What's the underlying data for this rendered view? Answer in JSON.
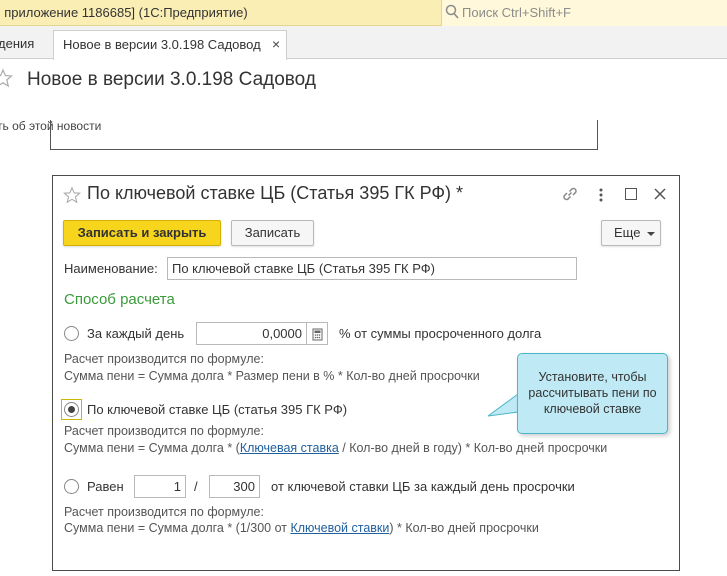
{
  "window": {
    "title": ", приложение 1186685]  (1С:Предприятие)",
    "search_placeholder": "Поиск Ctrl+Shift+F"
  },
  "tabs": [
    {
      "label": "дения"
    },
    {
      "label": "Новое в версии 3.0.198 Садовод",
      "close": "×"
    }
  ],
  "page": {
    "title": "Новое в версии 3.0.198 Садовод",
    "link": "ть об этой новости"
  },
  "dialog": {
    "title": "По ключевой ставке ЦБ (Статья 395 ГК РФ) *",
    "buttons": {
      "save_close": "Записать и закрыть",
      "save": "Записать",
      "more": "Еще"
    },
    "name_label": "Наименование:",
    "name_value": "По ключевой ставке ЦБ (Статья 395 ГК РФ)",
    "section_title": "Способ расчета",
    "options": [
      {
        "label": "За каждый день",
        "value": "0,0000",
        "suffix": "% от суммы просроченного долга",
        "selected": false,
        "formula_intro": "Расчет производится по формуле:",
        "formula": "Сумма пени = Сумма долга * Размер пени в % * Кол-во дней просрочки"
      },
      {
        "label": "По ключевой ставке ЦБ (статья 395 ГК РФ)",
        "selected": true,
        "formula_intro": "Расчет производится по формуле:",
        "formula_prefix": "Сумма пени = Сумма долга * (",
        "formula_link": "Ключевая ставка",
        "formula_suffix": " / Кол-во дней в году) * Кол-во дней просрочки"
      },
      {
        "label": "Равен",
        "numerator": "1",
        "slash": "/",
        "denominator": "300",
        "suffix": "от ключевой ставки ЦБ за каждый день просрочки",
        "selected": false,
        "formula_intro": "Расчет производится по формуле:",
        "formula_prefix": "Сумма пени = Сумма долга * (1/300 от ",
        "formula_link": "Ключевой ставки",
        "formula_suffix": ") * Кол-во дней просрочки"
      }
    ]
  },
  "callout": {
    "text": "Установите, чтобы рассчитывать пени по ключевой ставке"
  }
}
